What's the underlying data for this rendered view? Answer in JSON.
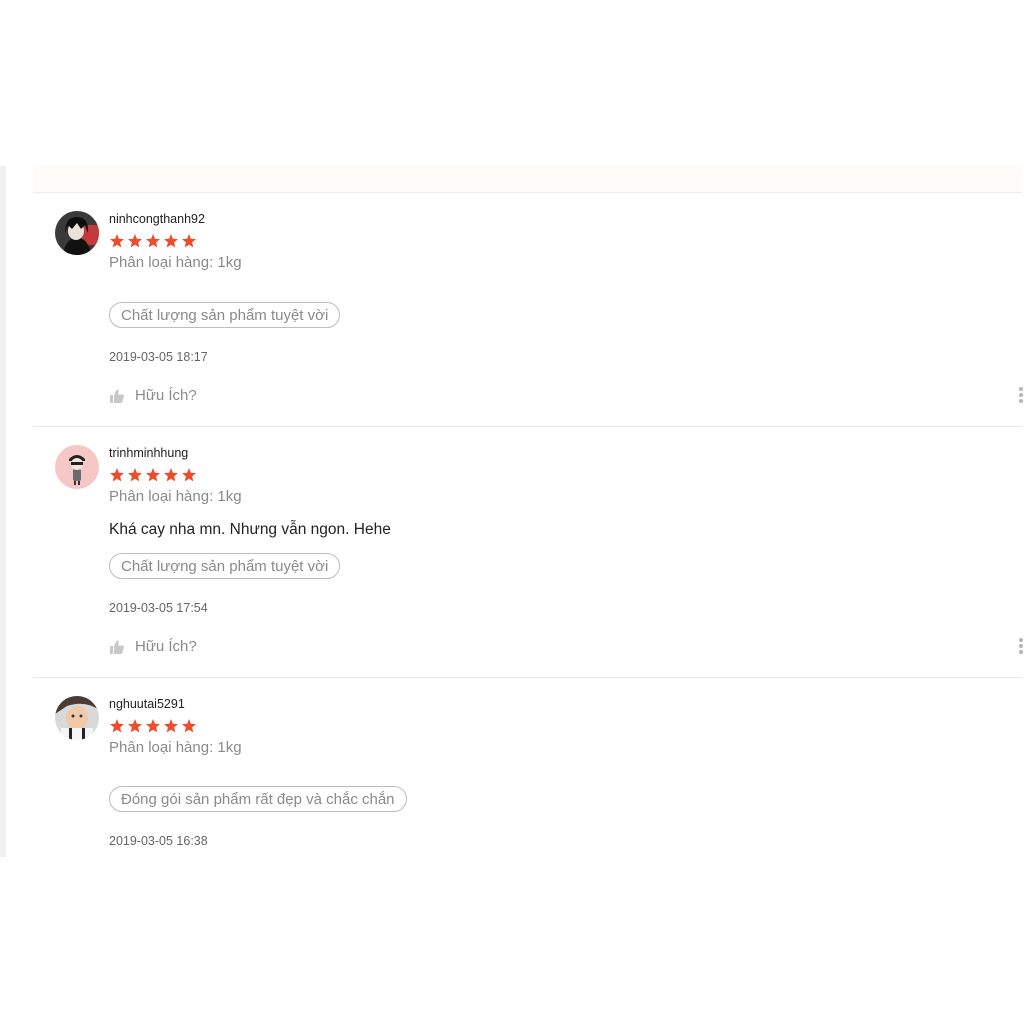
{
  "colors": {
    "star": "#ee4d2d",
    "muted": "#8a8a8a"
  },
  "reviews": [
    {
      "username": "ninhcongthanh92",
      "rating": 5,
      "variation": "Phân loại hàng: 1kg",
      "comment": "",
      "tag": "Chất lượng sản phẩm tuyệt vời",
      "timestamp": "2019-03-05 18:17",
      "helpful_label": "Hữu Ích?",
      "avatar_icon": "avatar-anime-icon"
    },
    {
      "username": "trinhminhhung",
      "rating": 5,
      "variation": "Phân loại hàng: 1kg",
      "comment": "Khá cay nha mn. Nhưng vẫn ngon. Hehe",
      "tag": "Chất lượng sản phẩm tuyệt vời",
      "timestamp": "2019-03-05 17:54",
      "helpful_label": "Hữu Ích?",
      "avatar_icon": "avatar-cartoon-icon"
    },
    {
      "username": "nghuutai5291",
      "rating": 5,
      "variation": "Phân loại hàng: 1kg",
      "comment": "",
      "tag": "Đóng gói sản phẩm rất đẹp và chắc chắn",
      "timestamp": "2019-03-05 16:38",
      "helpful_label": "",
      "avatar_icon": "avatar-baby-icon"
    }
  ]
}
